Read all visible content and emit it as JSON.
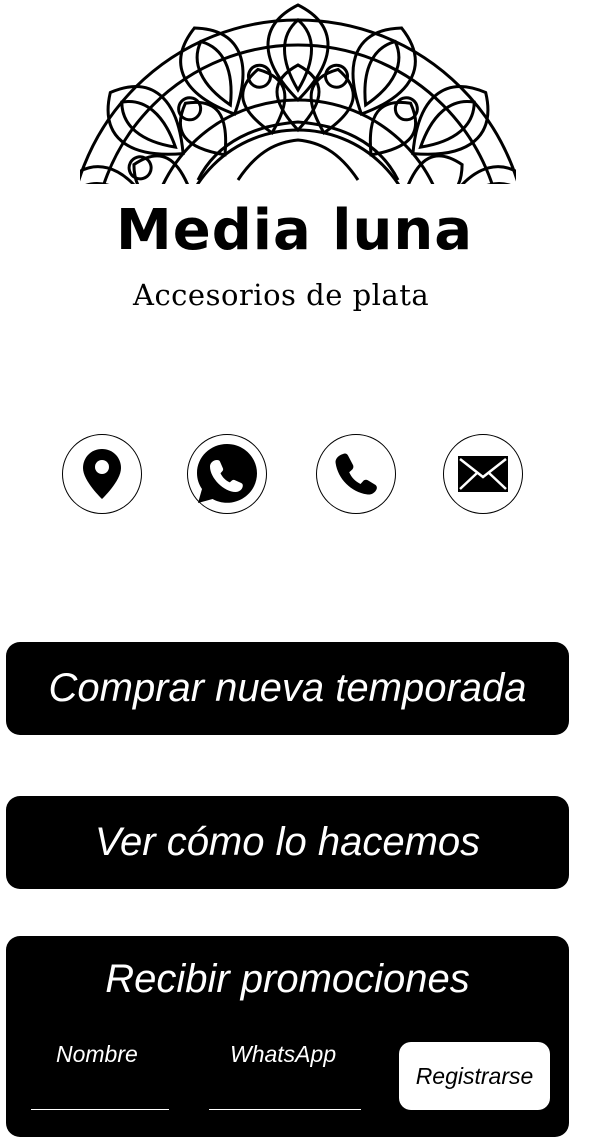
{
  "brand": {
    "title": "Media luna",
    "subtitle": "Accesorios de plata",
    "logo_icon": "mandala-icon"
  },
  "contact_icons": [
    {
      "icon": "location-pin-icon"
    },
    {
      "icon": "whatsapp-icon"
    },
    {
      "icon": "phone-icon"
    },
    {
      "icon": "email-icon"
    }
  ],
  "buttons": {
    "shop": "Comprar nueva temporada",
    "how": "Ver cómo lo hacemos"
  },
  "promo": {
    "title": "Recibir promociones",
    "name_label": "Nombre",
    "whatsapp_label": "WhatsApp",
    "submit": "Registrarse"
  },
  "colors": {
    "background": "#ffffff",
    "button": "#000000",
    "button_text": "#ffffff"
  }
}
